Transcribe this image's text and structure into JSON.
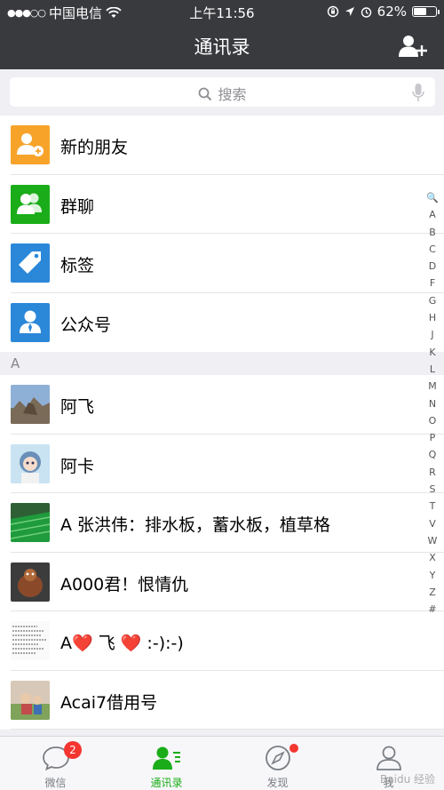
{
  "status_bar": {
    "signal": "●●●○○",
    "carrier": "中国电信",
    "time": "上午11:56",
    "battery_percent": "62%",
    "battery_level": 0.62
  },
  "nav": {
    "title": "通讯录"
  },
  "search": {
    "placeholder": "搜索"
  },
  "functions": [
    {
      "label": "新的朋友",
      "icon": "new-friends-icon",
      "color": "#f7a32a"
    },
    {
      "label": "群聊",
      "icon": "group-chat-icon",
      "color": "#1aad19"
    },
    {
      "label": "标签",
      "icon": "tag-icon",
      "color": "#2b87d8"
    },
    {
      "label": "公众号",
      "icon": "official-account-icon",
      "color": "#2b87d8"
    }
  ],
  "sections": [
    {
      "header": "A",
      "contacts": [
        {
          "name": "阿飞"
        },
        {
          "name": "阿卡"
        },
        {
          "name": "A 张洪伟：排水板，蓄水板，植草格"
        },
        {
          "name": "A000君！恨情仇"
        },
        {
          "name": "A❤️ 飞 ❤️ :-):-)"
        },
        {
          "name": "Acai7借用号"
        }
      ]
    }
  ],
  "index_letters": [
    "🔍",
    "A",
    "B",
    "C",
    "D",
    "F",
    "G",
    "H",
    "J",
    "K",
    "L",
    "M",
    "N",
    "O",
    "P",
    "Q",
    "R",
    "S",
    "T",
    "V",
    "W",
    "X",
    "Y",
    "Z",
    "#"
  ],
  "tabs": [
    {
      "label": "微信",
      "badge": "2"
    },
    {
      "label": "通讯录",
      "active": true
    },
    {
      "label": "发现",
      "dot": true
    },
    {
      "label": "我"
    }
  ],
  "watermark": "Baidu 经验",
  "colors": {
    "accent": "#1aad19",
    "header": "#393a3e",
    "badge": "#f43530"
  }
}
